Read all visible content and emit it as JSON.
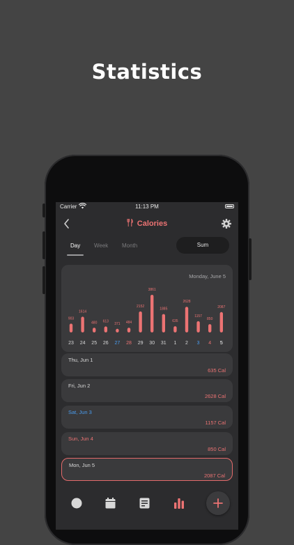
{
  "hero_title": "Statistics",
  "status_bar": {
    "carrier": "Carrier",
    "time": "11:13 PM"
  },
  "nav": {
    "title": "Calories",
    "back_icon": "chevron-left-icon",
    "title_icon": "fork-knife-icon",
    "settings_icon": "gear-icon"
  },
  "tabs": [
    {
      "label": "Day",
      "active": true
    },
    {
      "label": "Week",
      "active": false
    },
    {
      "label": "Month",
      "active": false
    }
  ],
  "sum_button": "Sum",
  "chart_header": "Monday, June 5",
  "chart_data": {
    "type": "bar",
    "categories": [
      "23",
      "24",
      "25",
      "26",
      "27",
      "28",
      "29",
      "30",
      "31",
      "1",
      "2",
      "3",
      "4",
      "5"
    ],
    "values": [
      903,
      1614,
      480,
      613,
      371,
      484,
      2152,
      3861,
      1885,
      635,
      2628,
      1157,
      850,
      2087
    ],
    "category_colors": [
      "#d8d8d8",
      "#d8d8d8",
      "#d8d8d8",
      "#d8d8d8",
      "#4a9df0",
      "#ec7373",
      "#d8d8d8",
      "#d8d8d8",
      "#d8d8d8",
      "#d8d8d8",
      "#d8d8d8",
      "#4a9df0",
      "#ec7373",
      "#ffffff"
    ],
    "bar_color": "#ec7373",
    "ylim": [
      0,
      3861
    ],
    "grid": false,
    "value_labels": true
  },
  "entries": [
    {
      "date": "Thu, Jun 1",
      "calories": "635 Cal",
      "date_color": "#d8d8d8",
      "selected": false
    },
    {
      "date": "Fri, Jun 2",
      "calories": "2628 Cal",
      "date_color": "#d8d8d8",
      "selected": false
    },
    {
      "date": "Sat, Jun 3",
      "calories": "1157 Cal",
      "date_color": "#4a9df0",
      "selected": false
    },
    {
      "date": "Sun, Jun 4",
      "calories": "850 Cal",
      "date_color": "#ec7373",
      "selected": false
    },
    {
      "date": "Mon, Jun 5",
      "calories": "2087 Cal",
      "date_color": "#d8d8d8",
      "selected": true
    }
  ],
  "tab_bar": {
    "items": [
      "circle-icon",
      "calendar-icon",
      "notes-icon",
      "bar-chart-icon"
    ],
    "active_color": "#ec7373",
    "fab_icon": "plus-icon"
  },
  "colors": {
    "accent": "#ec7373",
    "weekend_blue": "#4a9df0",
    "background": "#2c2c2e",
    "card": "#3a3a3c"
  }
}
